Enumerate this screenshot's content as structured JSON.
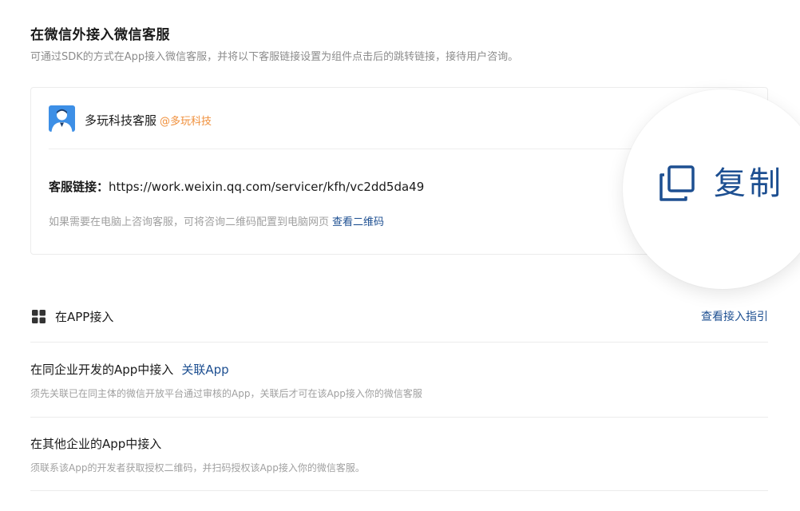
{
  "section": {
    "title": "在微信外接入微信客服",
    "subtitle": "可通过SDK的方式在App接入微信客服，并将以下客服链接设置为组件点击后的跳转链接，接待用户咨询。"
  },
  "card": {
    "name": "多玩科技客服",
    "org": "@多玩科技",
    "link_label": "客服链接：",
    "link_url": "https://work.weixin.qq.com/servicer/kfh/vc2dd5da49",
    "hint": "如果需要在电脑上咨询客服，可将咨询二维码配置到电脑网页",
    "view_qr_label": "查看二维码"
  },
  "copy": {
    "label": "复制",
    "color": "#1d4f91"
  },
  "app_section": {
    "title": "在APP接入",
    "guide_label": "查看接入指引"
  },
  "rows": [
    {
      "title": "在同企业开发的App中接入",
      "link": "关联App",
      "desc": "须先关联已在同主体的微信开放平台通过审核的App，关联后才可在该App接入你的微信客服"
    },
    {
      "title": "在其他企业的App中接入",
      "desc": "须联系该App的开发者获取授权二维码，并扫码授权该App接入你的微信客服。"
    }
  ],
  "colors": {
    "accent": "#1d4f91",
    "org": "#f0903c",
    "muted": "#a0a0a0",
    "avatar_bg": "#3d8fe6"
  },
  "icons": {
    "avatar": "person-avatar-icon",
    "copy": "copy-icon",
    "app": "grid-icon"
  }
}
